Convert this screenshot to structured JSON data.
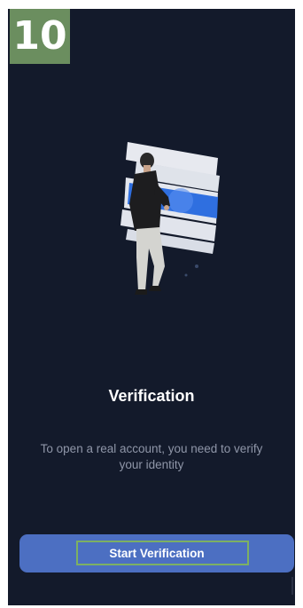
{
  "step": {
    "number": "10",
    "color": "#6b8e5f"
  },
  "screen": {
    "background": "#131a2b",
    "illustration": "person-verification-illustration",
    "title": "Verification",
    "subtitle": "To open a real account, you need to verify your identity",
    "primary_button": {
      "label": "Start Verification",
      "color": "#4c6fc2",
      "highlight_color": "#7db063"
    }
  }
}
